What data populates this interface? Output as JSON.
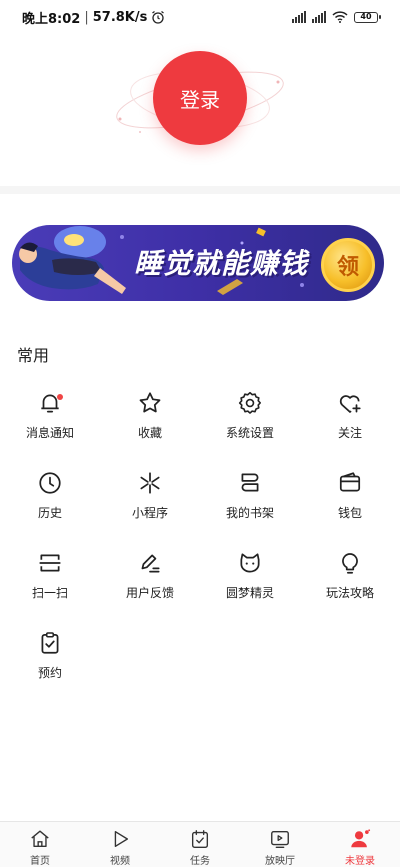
{
  "status_bar": {
    "time": "晚上8:02",
    "speed": "57.8K/s",
    "battery": "40"
  },
  "login": {
    "label": "登录"
  },
  "banner": {
    "text": "睡觉就能赚钱",
    "coin_label": "领",
    "slides": 3,
    "active_slide": 3
  },
  "common": {
    "title": "常用",
    "items": [
      {
        "label": "消息通知",
        "icon": "bell-icon"
      },
      {
        "label": "收藏",
        "icon": "star-icon"
      },
      {
        "label": "系统设置",
        "icon": "gear-icon"
      },
      {
        "label": "关注",
        "icon": "heart-plus-icon"
      },
      {
        "label": "历史",
        "icon": "clock-icon"
      },
      {
        "label": "小程序",
        "icon": "mini-program-icon"
      },
      {
        "label": "我的书架",
        "icon": "bookshelf-icon"
      },
      {
        "label": "钱包",
        "icon": "wallet-icon"
      },
      {
        "label": "扫一扫",
        "icon": "scan-icon"
      },
      {
        "label": "用户反馈",
        "icon": "feedback-pen-icon"
      },
      {
        "label": "圆梦精灵",
        "icon": "cat-face-icon"
      },
      {
        "label": "玩法攻略",
        "icon": "bulb-icon"
      },
      {
        "label": "预约",
        "icon": "clipboard-check-icon"
      }
    ]
  },
  "tabbar": {
    "tabs": [
      {
        "label": "首页",
        "icon": "home-icon"
      },
      {
        "label": "视频",
        "icon": "play-icon"
      },
      {
        "label": "任务",
        "icon": "task-calendar-icon"
      },
      {
        "label": "放映厅",
        "icon": "screening-room-icon"
      },
      {
        "label": "未登录",
        "icon": "user-icon",
        "active": true
      }
    ]
  },
  "colors": {
    "accent": "#ee3a3f",
    "banner": "#3e2fa6",
    "coin": "#f7bf2a"
  }
}
